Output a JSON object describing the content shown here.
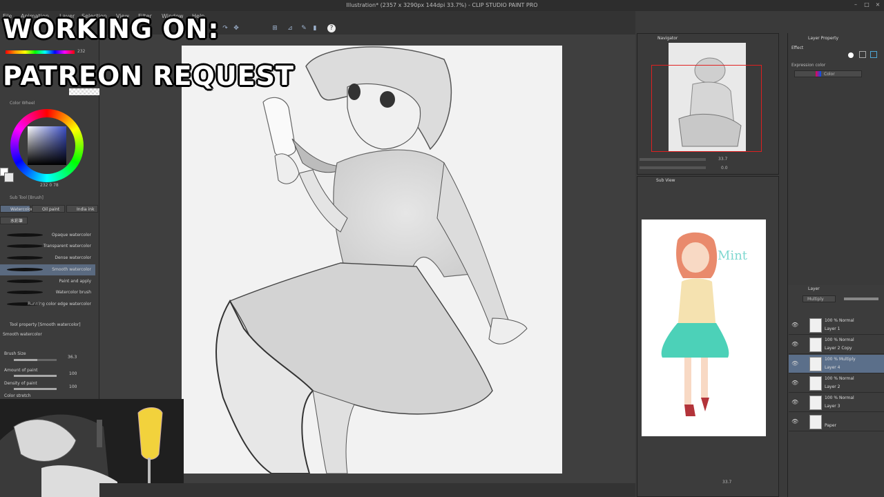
{
  "window": {
    "title": "Illustration* (2357 x 3290px 144dpi 33.7%) - CLIP STUDIO PAINT PRO"
  },
  "menu": [
    "File",
    "Animation",
    "Layer",
    "Selection",
    "View",
    "Filter",
    "Window",
    "Help"
  ],
  "overlay": {
    "line1": "WORKING ON:",
    "line2": "PATREON REQUEST"
  },
  "color_panel": {
    "tab": "Color Wheel",
    "bar_value": "232",
    "values": "232 0 78"
  },
  "subtool": {
    "group_label": "Sub Tool [Brush]",
    "tabs": [
      "Watercolor",
      "Oil paint",
      "India ink"
    ],
    "small_tab": "水彩筆",
    "brushes": [
      {
        "label": "Opaque watercolor"
      },
      {
        "label": "Transparent watercolor"
      },
      {
        "label": "Dense watercolor"
      },
      {
        "label": "Smooth watercolor"
      },
      {
        "label": "Paint and apply"
      },
      {
        "label": "Watercolor brush"
      },
      {
        "label": "Running color edge watercolor"
      }
    ],
    "selected_index": 3
  },
  "tool_property": {
    "header": "Tool property [Smooth watercolor]",
    "preset": "Smooth watercolor",
    "brush_size_label": "Brush Size",
    "brush_size_value": "36.3",
    "amount_label": "Amount of paint",
    "amount_value": "100",
    "density_label": "Density of paint",
    "density_value": "100",
    "color_stretch_label": "Color stretch"
  },
  "navigator": {
    "tab": "Navigator",
    "zoom": "33.7",
    "angle": "0.0"
  },
  "subview": {
    "tab": "Sub View",
    "reference_text": "Mint"
  },
  "layer_property": {
    "tab": "Layer Property",
    "effect_label": "Effect",
    "expression_label": "Expression color",
    "expression_value": "Color"
  },
  "layers": {
    "tab": "Layer",
    "blend_mode": "Multiply",
    "items": [
      {
        "mode": "100 % Normal",
        "name": "Layer 1"
      },
      {
        "mode": "100 % Normal",
        "name": "Layer 2 Copy"
      },
      {
        "mode": "100 % Multiply",
        "name": "Layer 4"
      },
      {
        "mode": "100 % Normal",
        "name": "Layer 2"
      },
      {
        "mode": "100 % Normal",
        "name": "Layer 3"
      },
      {
        "mode": "",
        "name": "Paper"
      }
    ],
    "selected_index": 2
  },
  "status": {
    "zoom": "33.7"
  },
  "colors": {
    "accent": "#5b6f8a",
    "nav_frame": "#e02020"
  }
}
